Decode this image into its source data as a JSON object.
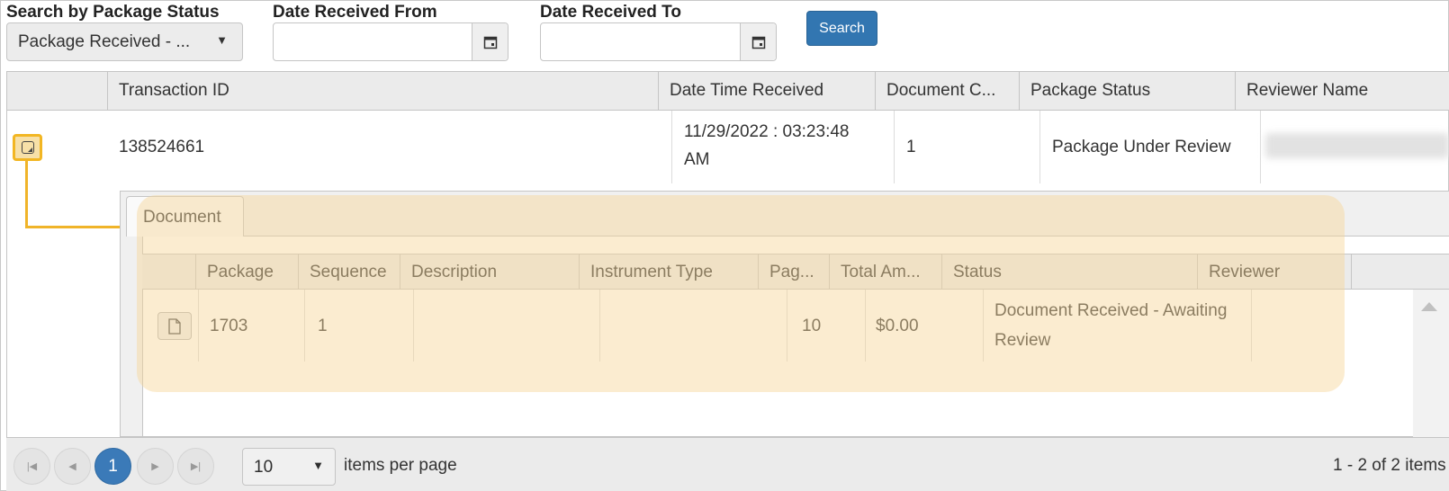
{
  "filters": {
    "status_label": "Search by Package Status",
    "status_value": "Package Received - ...",
    "date_from_label": "Date Received From",
    "date_from_value": "",
    "date_to_label": "Date Received To",
    "date_to_value": "",
    "search_label": "Search"
  },
  "grid": {
    "columns": [
      "",
      "Transaction ID",
      "Date Time Received",
      "Document C...",
      "Package Status",
      "Reviewer Name"
    ],
    "row": {
      "transaction_id": "138524661",
      "date_line1": "11/29/2022 : 03:23:48",
      "date_line2": "AM",
      "document_count": "1",
      "package_status": "Package Under Review",
      "reviewer_name": ""
    }
  },
  "detail": {
    "tab_label": "Document",
    "columns": [
      "",
      "Package",
      "Sequence",
      "Description",
      "Instrument Type",
      "Pag...",
      "Total Am...",
      "Status",
      "Reviewer"
    ],
    "row": {
      "package": "1703",
      "sequence": "1",
      "description": "",
      "instrument_type": "",
      "pages": "10",
      "total_amount": "$0.00",
      "status_line1": "Document Received - Awaiting",
      "status_line2": "Review",
      "reviewer": ""
    }
  },
  "pager": {
    "current_page": "1",
    "page_size": "10",
    "items_per_page_label": "items per page",
    "summary": "1 - 2 of 2 items"
  },
  "colors": {
    "accent": "#3276b1",
    "highlight": "#f2b623"
  }
}
